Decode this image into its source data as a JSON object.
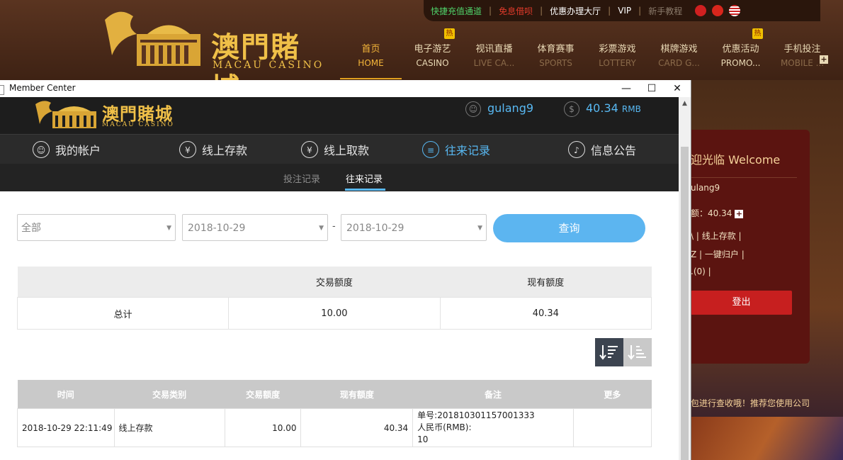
{
  "site": {
    "toplinks": [
      {
        "label": "快捷充值通道",
        "color": "#4fd26a"
      },
      {
        "label": "免息借呗",
        "color": "#e03a2a"
      },
      {
        "label": "优惠办理大厅",
        "color": "#ffffff"
      },
      {
        "label": "VIP",
        "color": "#ffffff"
      },
      {
        "label": "新手教程",
        "color": "#8a7a6a"
      }
    ],
    "separator": "|",
    "logo": {
      "cn": "澳門賭城",
      "en": "MACAU CASINO"
    },
    "nav": [
      {
        "cn": "首页",
        "en": "HOME"
      },
      {
        "cn": "电子游艺",
        "en": "CASINO",
        "badge": "热"
      },
      {
        "cn": "视讯直播",
        "en": "LIVE CA..."
      },
      {
        "cn": "体育赛事",
        "en": "SPORTS"
      },
      {
        "cn": "彩票游戏",
        "en": "LOTTERY"
      },
      {
        "cn": "棋牌游戏",
        "en": "CARD G..."
      },
      {
        "cn": "优惠活动",
        "en": "PROMO...",
        "badge": "热"
      },
      {
        "cn": "手机投注",
        "en": "MOBILE ..."
      }
    ],
    "nav_plus": "+",
    "welcome": {
      "title": "迎光临 Welcome",
      "user": "ulang9",
      "balance": "额：40.34",
      "links1": "\\ | 线上存款 |",
      "links2": "Z | 一键归户 |",
      "links3": ".(0) |",
      "logout": "登出"
    },
    "marquee": "包进行查收哦！推荐您使用公司"
  },
  "window": {
    "title": "Member Center",
    "controls": {
      "minimize": "—",
      "maximize": "☐",
      "close": "✕"
    }
  },
  "member": {
    "logo": {
      "cn": "澳門賭城",
      "en": "MACAU CASINO"
    },
    "username": "gulang9",
    "balance": "40.34",
    "currency": "RMB",
    "nav": [
      {
        "label": "我的帐户",
        "icon": "user-icon"
      },
      {
        "label": "线上存款",
        "icon": "deposit-icon"
      },
      {
        "label": "线上取款",
        "icon": "withdraw-icon"
      },
      {
        "label": "往来记录",
        "icon": "records-icon"
      },
      {
        "label": "信息公告",
        "icon": "bell-icon"
      }
    ],
    "subtabs": [
      {
        "label": "投注记录"
      },
      {
        "label": "往来记录"
      }
    ],
    "filter": {
      "type": "全部",
      "start_date": "2018-10-29",
      "end_date": "2018-10-29",
      "dash": "-",
      "query": "查询"
    },
    "summary": {
      "headers": [
        "",
        "交易额度",
        "现有额度"
      ],
      "row": [
        "总计",
        "10.00",
        "40.34"
      ]
    },
    "records": {
      "headers": [
        "时间",
        "交易类别",
        "交易额度",
        "现有额度",
        "备注",
        "更多"
      ],
      "rows": [
        {
          "time": "2018-10-29 22:11:49",
          "type": "线上存款",
          "amount": "10.00",
          "balance": "40.34",
          "note": [
            "单号:201810301157001333",
            "人民币(RMB):",
            "10"
          ],
          "more": ""
        }
      ]
    }
  },
  "colors": {
    "accent": "#58b8f2",
    "gold": "#f0c048",
    "header_bg": "#1d1d1d"
  }
}
